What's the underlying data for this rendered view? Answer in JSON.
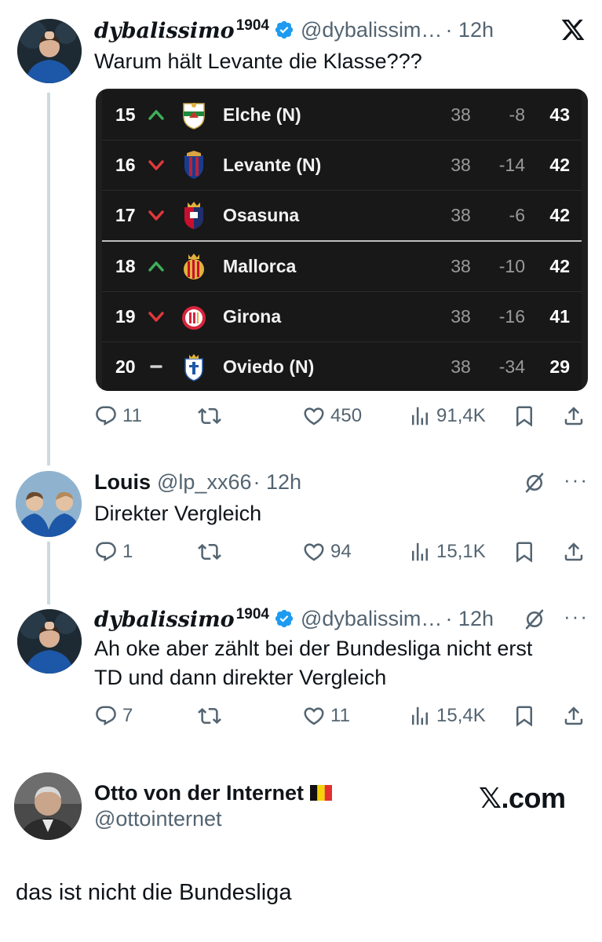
{
  "tweet1": {
    "display_name": "dybalissimo",
    "name_sup": "1904",
    "handle": "@dybalissim…",
    "time": "· 12h",
    "text": "Warum hält Levante die Klasse???",
    "stats": {
      "replies": "11",
      "likes": "450",
      "views": "91,4K"
    }
  },
  "table": {
    "rows": [
      {
        "pos": "15",
        "trend": "up",
        "team": "Elche (N)",
        "played": "38",
        "gd": "-8",
        "pts": "43"
      },
      {
        "pos": "16",
        "trend": "down",
        "team": "Levante (N)",
        "played": "38",
        "gd": "-14",
        "pts": "42"
      },
      {
        "pos": "17",
        "trend": "down",
        "team": "Osasuna",
        "played": "38",
        "gd": "-6",
        "pts": "42"
      },
      {
        "pos": "18",
        "trend": "up",
        "team": "Mallorca",
        "played": "38",
        "gd": "-10",
        "pts": "42"
      },
      {
        "pos": "19",
        "trend": "down",
        "team": "Girona",
        "played": "38",
        "gd": "-16",
        "pts": "41"
      },
      {
        "pos": "20",
        "trend": "same",
        "team": "Oviedo (N)",
        "played": "38",
        "gd": "-34",
        "pts": "29"
      }
    ]
  },
  "tweet2": {
    "display_name": "Louis",
    "handle": "@lp_xx66",
    "time": "· 12h",
    "text": "Direkter Vergleich",
    "stats": {
      "replies": "1",
      "likes": "94",
      "views": "15,1K"
    }
  },
  "tweet3": {
    "display_name": "dybalissimo",
    "name_sup": "1904",
    "handle": "@dybalissim…",
    "time": "· 12h",
    "text_line1": "Ah oke aber zählt bei der Bundesliga nicht erst",
    "text_line2": "TD und dann direkter Vergleich",
    "stats": {
      "replies": "7",
      "likes": "11",
      "views": "15,4K"
    }
  },
  "quote": {
    "display_name": "Otto von der Internet",
    "handle": "@ottointernet",
    "brand": "𝕏.com",
    "text": "das ist nicht die Bundesliga"
  },
  "icons": {
    "logo": "x-logo-icon",
    "reply": "reply-icon",
    "retweet": "retweet-icon",
    "like": "heart-icon",
    "views": "views-icon",
    "bookmark": "bookmark-icon",
    "share": "share-icon",
    "more": "more-icon",
    "grok": "grok-icon",
    "verified": "verified-badge-icon",
    "flag": "belgium-flag-icon"
  },
  "colors": {
    "verified": "#1d9bf0",
    "muted": "#536471",
    "table_bg": "#181818",
    "trend_up": "#3fae5a",
    "trend_down": "#e0383b"
  }
}
